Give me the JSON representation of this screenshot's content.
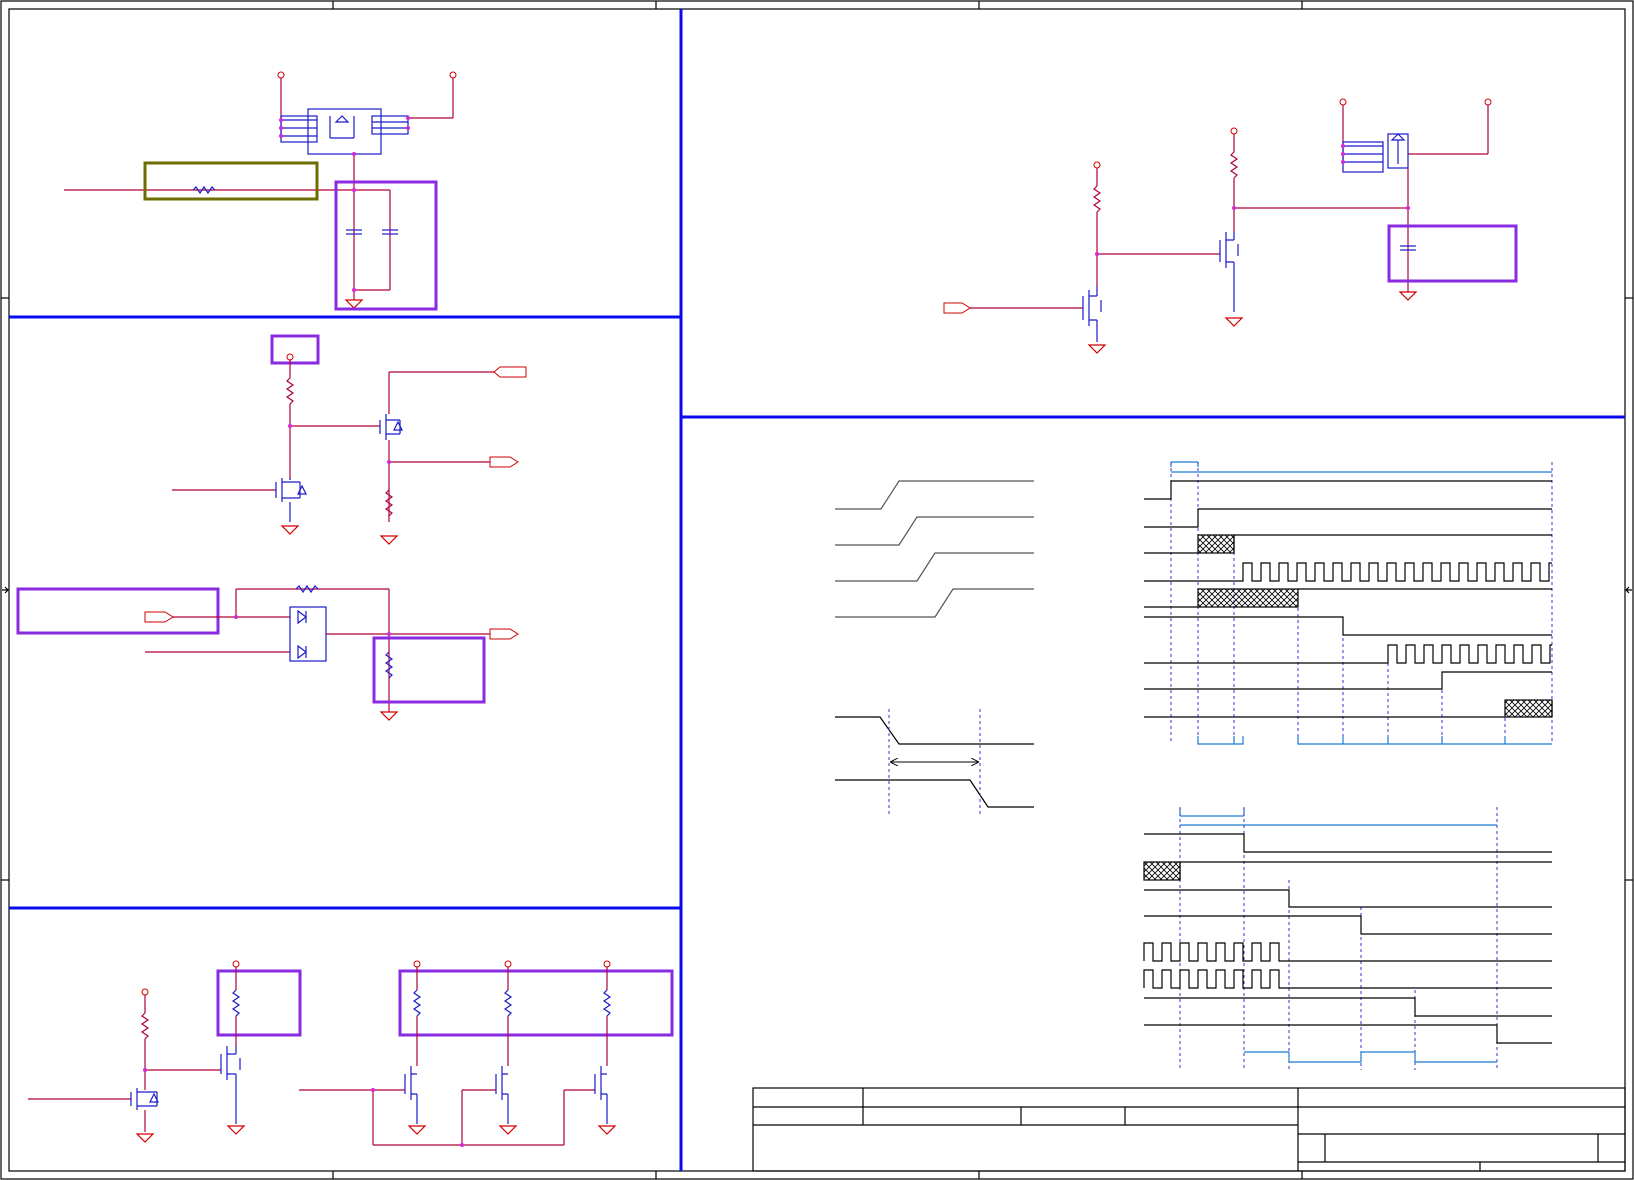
{
  "sheet": {
    "title": "",
    "frame_color": "#000000",
    "wire_color": "#b0003a",
    "component_color": "#1a1acc",
    "group_box_color": "#8a2be2",
    "separator_color": "#0a0aee"
  },
  "sections": [
    {
      "id": "power-switch-top-left",
      "groups": [
        "filter-box",
        "cap-box"
      ]
    },
    {
      "id": "mosfet-driver-top-right",
      "groups": [
        "cap-box"
      ]
    },
    {
      "id": "level-shift-middle-left",
      "groups": [
        "label-box",
        "input-box",
        "pulldown-box"
      ]
    },
    {
      "id": "timing-diagrams",
      "groups": [
        "ramp-waveforms",
        "sequence-waveforms-top",
        "sequence-waveforms-bottom"
      ]
    },
    {
      "id": "pullup-array-bottom-left",
      "groups": [
        "pullup-box-single",
        "pullup-box-triple"
      ]
    }
  ],
  "title_block": {
    "title": "",
    "project": "",
    "sheet": "",
    "revision": "",
    "date": ""
  },
  "icons": [
    "power-port-icon",
    "ground-icon",
    "resistor-icon",
    "capacitor-icon",
    "mosfet-icon",
    "diode-icon",
    "net-label-icon"
  ]
}
